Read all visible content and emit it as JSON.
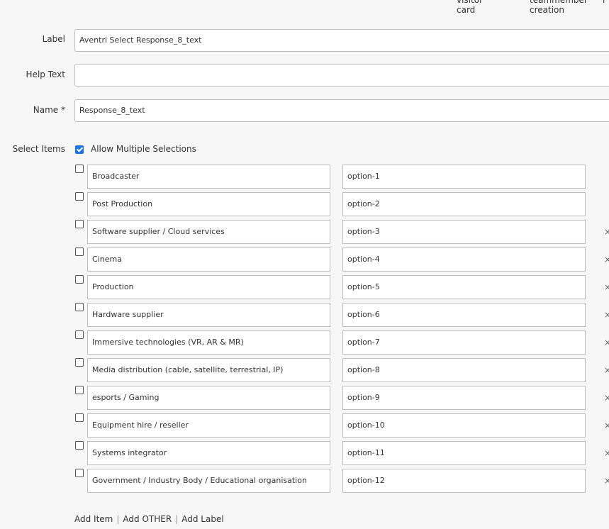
{
  "column_headers": {
    "visitor_card": [
      "visitor",
      "card"
    ],
    "teammember_creation": [
      "teammember",
      "creation"
    ]
  },
  "form": {
    "label": {
      "caption": "Label",
      "value": "Aventri Select Response_8_text"
    },
    "help_text": {
      "caption": "Help Text",
      "value": ""
    },
    "name": {
      "caption": "Name *",
      "value": "Response_8_text"
    }
  },
  "select_items": {
    "caption": "Select Items",
    "allow_multiple": {
      "label": "Allow Multiple Selections",
      "checked": true
    },
    "remove_glyph": "×",
    "items": [
      {
        "label": "Broadcaster",
        "value": "option-1",
        "removable": false
      },
      {
        "label": "Post Production",
        "value": "option-2",
        "removable": false
      },
      {
        "label": "Software supplier / Cloud services",
        "value": "option-3",
        "removable": true
      },
      {
        "label": "Cinema",
        "value": "option-4",
        "removable": true
      },
      {
        "label": "Production",
        "value": "option-5",
        "removable": true
      },
      {
        "label": "Hardware supplier",
        "value": "option-6",
        "removable": true
      },
      {
        "label": "Immersive technologies (VR, AR & MR)",
        "value": "option-7",
        "removable": true
      },
      {
        "label": "Media distribution (cable, satellite, terrestrial, IP)",
        "value": "option-8",
        "removable": true
      },
      {
        "label": "esports / Gaming",
        "value": "option-9",
        "removable": true
      },
      {
        "label": "Equipment hire / reseller",
        "value": "option-10",
        "removable": true
      },
      {
        "label": "Systems integrator",
        "value": "option-11",
        "removable": true
      },
      {
        "label": "Government / Industry Body / Educational organisation",
        "value": "option-12",
        "removable": true
      }
    ]
  },
  "footer": {
    "add_item": "Add Item",
    "add_other": "Add OTHER",
    "add_label": "Add Label",
    "separator": "|"
  },
  "colors": {
    "checkbox_accent": "#1a73e8",
    "field_border": "#bdbdbd",
    "background": "#f7f7f7"
  }
}
